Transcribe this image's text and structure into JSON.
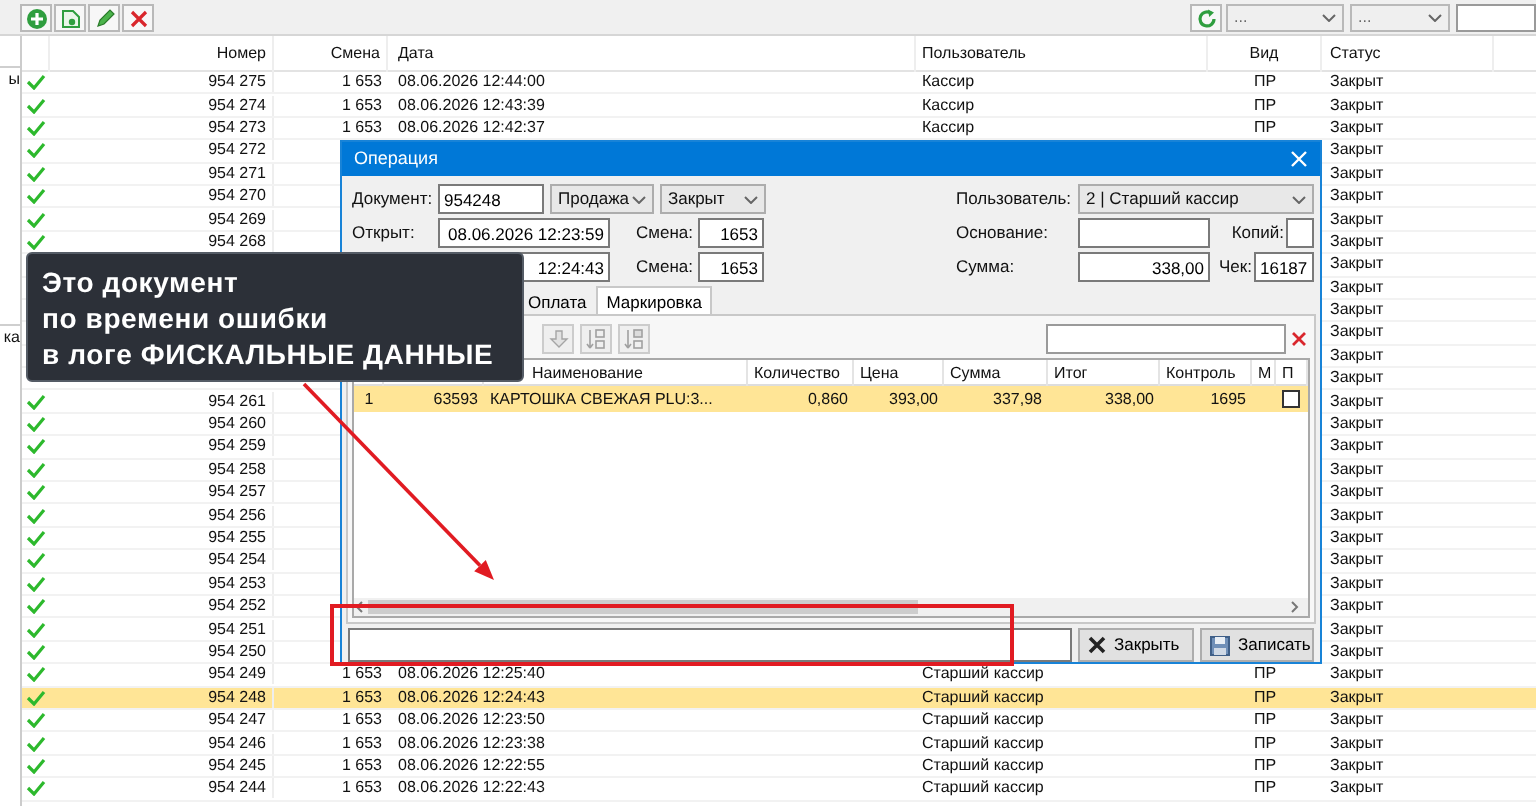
{
  "toolbar": {
    "filters": [
      "...",
      "..."
    ]
  },
  "left_panel": {
    "items": [
      "ы",
      "ка"
    ]
  },
  "table": {
    "columns": [
      "Номер",
      "Смена",
      "Дата",
      "Пользователь",
      "Вид",
      "Статус"
    ],
    "rows": [
      {
        "number": "954 275",
        "shift": "1 653",
        "date": "08.06.2026 12:44:00",
        "user": "Кассир",
        "type": "ПР",
        "status": "Закрыт",
        "selected": false
      },
      {
        "number": "954 274",
        "shift": "1 653",
        "date": "08.06.2026 12:43:39",
        "user": "Кассир",
        "type": "ПР",
        "status": "Закрыт",
        "selected": false
      },
      {
        "number": "954 273",
        "shift": "1 653",
        "date": "08.06.2026 12:42:37",
        "user": "Кассир",
        "type": "ПР",
        "status": "Закрыт",
        "selected": false
      },
      {
        "number": "954 272",
        "status": "Закрыт",
        "selected": false
      },
      {
        "number": "954 271",
        "status": "Закрыт",
        "selected": false
      },
      {
        "number": "954 270",
        "status": "Закрыт",
        "selected": false
      },
      {
        "number": "954 269",
        "status": "Закрыт",
        "selected": false
      },
      {
        "number": "954 268",
        "status": "Закрыт",
        "selected": false
      },
      {
        "status": "Закрыт",
        "selected": false
      },
      {
        "status": "Закрыт",
        "selected": false
      },
      {
        "status": "Закрыт",
        "selected": false
      },
      {
        "status": "Закрыт",
        "selected": false
      },
      {
        "status": "Закрыт",
        "selected": false
      },
      {
        "status": "Закрыт",
        "selected": false
      },
      {
        "number": "954 261",
        "status": "Закрыт",
        "selected": false
      },
      {
        "number": "954 260",
        "status": "Закрыт",
        "selected": false
      },
      {
        "number": "954 259",
        "status": "Закрыт",
        "selected": false
      },
      {
        "number": "954 258",
        "status": "Закрыт",
        "selected": false
      },
      {
        "number": "954 257",
        "status": "Закрыт",
        "selected": false
      },
      {
        "number": "954 256",
        "status": "Закрыт",
        "selected": false
      },
      {
        "number": "954 255",
        "status": "Закрыт",
        "selected": false
      },
      {
        "number": "954 254",
        "status": "Закрыт",
        "selected": false
      },
      {
        "number": "954 253",
        "status": "Закрыт",
        "selected": false
      },
      {
        "number": "954 252",
        "status": "Закрыт",
        "selected": false
      },
      {
        "number": "954 251",
        "status": "Закрыт",
        "selected": false
      },
      {
        "number": "954 250",
        "status": "Закрыт",
        "selected": false
      },
      {
        "number": "954 249",
        "shift": "1 653",
        "date": "08.06.2026 12:25:40",
        "user": "Старший кассир",
        "type": "ПР",
        "status": "Закрыт",
        "selected": false
      },
      {
        "number": "954 248",
        "shift": "1 653",
        "date": "08.06.2026 12:24:43",
        "user": "Старший кассир",
        "type": "ПР",
        "status": "Закрыт",
        "selected": true
      },
      {
        "number": "954 247",
        "shift": "1 653",
        "date": "08.06.2026 12:23:50",
        "user": "Старший кассир",
        "type": "ПР",
        "status": "Закрыт",
        "selected": false
      },
      {
        "number": "954 246",
        "shift": "1 653",
        "date": "08.06.2026 12:23:38",
        "user": "Старший кассир",
        "type": "ПР",
        "status": "Закрыт",
        "selected": false
      },
      {
        "number": "954 245",
        "shift": "1 653",
        "date": "08.06.2026 12:22:55",
        "user": "Старший кассир",
        "type": "ПР",
        "status": "Закрыт",
        "selected": false
      },
      {
        "number": "954 244",
        "shift": "1 653",
        "date": "08.06.2026 12:22:43",
        "user": "Старший кассир",
        "type": "ПР",
        "status": "Закрыт",
        "selected": false
      }
    ]
  },
  "dialog": {
    "title": "Операция",
    "document_label": "Документ:",
    "document": "954248",
    "operation": "Продажа",
    "state": "Закрыт",
    "user_label": "Пользователь:",
    "user": "2 | Старший кассир",
    "opened_label": "Открыт:",
    "opened": "08.06.2026 12:23:59",
    "opened_shift_label": "Смена:",
    "opened_shift": "1653",
    "basis_label": "Основание:",
    "copies_label": "Копий:",
    "changed": "12:24:43",
    "changed_shift_label": "Смена:",
    "changed_shift": "1653",
    "sum_label": "Сумма:",
    "sum": "338,00",
    "receipt_label": "Чек:",
    "receipt": "16187",
    "tabs": [
      {
        "label": "Оплата",
        "selected": false
      },
      {
        "label": "Маркировка",
        "selected": true
      }
    ],
    "grid": {
      "columns": [
        "Наименование",
        "Количество",
        "Цена",
        "Сумма",
        "Итог",
        "Контроль",
        "М",
        "П"
      ],
      "rows": [
        {
          "column_1": "1",
          "column_2": "63593",
          "cells": [
            "КАРТОШКА СВЕЖАЯ PLU:3...",
            "0,860",
            "393,00",
            "337,98",
            "338,00",
            "1695"
          ],
          "checked": false,
          "selected": true
        }
      ]
    },
    "buttons": [
      {
        "kind": "close",
        "label": "Закрыть"
      },
      {
        "kind": "save",
        "label": "Записать"
      }
    ]
  },
  "callout": {
    "text": "Это документ\nпо времени ошибки\nв логе ФИСКАЛЬНЫЕ ДАННЫЕ"
  }
}
